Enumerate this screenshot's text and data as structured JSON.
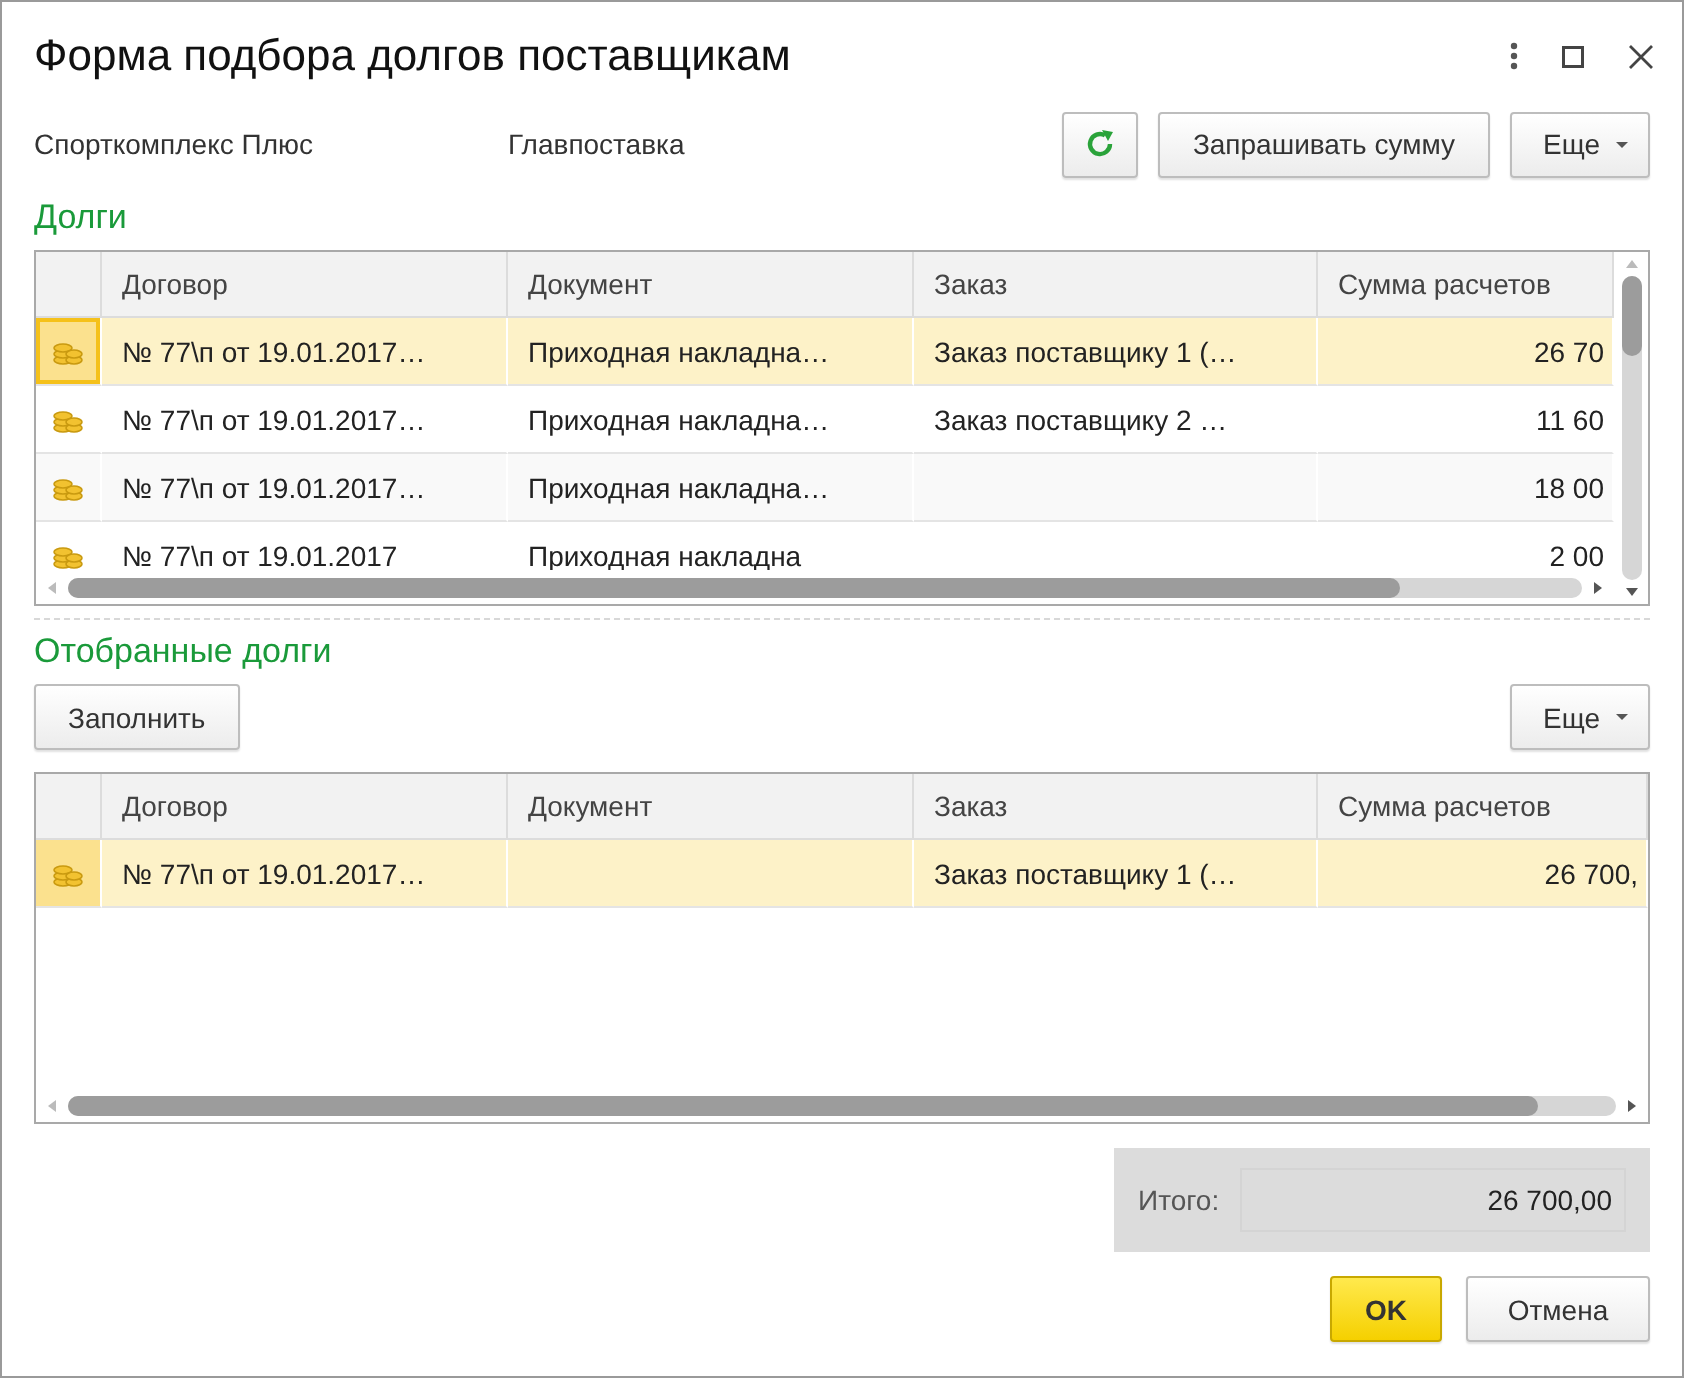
{
  "window": {
    "title": "Форма подбора долгов поставщикам"
  },
  "header": {
    "labels": [
      "Спорткомплекс Плюс",
      "Главпоставка"
    ],
    "buttons": [
      {
        "kind": "refresh"
      },
      {
        "kind": "text",
        "label": "Запрашивать сумму"
      },
      {
        "kind": "menu",
        "label": "Еще"
      }
    ]
  },
  "debts": {
    "title": "Долги",
    "columns": [
      "Договор",
      "Документ",
      "Заказ",
      "Сумма расчетов"
    ],
    "rows": [
      {
        "contract": "№ 77\\п от 19.01.2017…",
        "document": "Приходная накладна…",
        "order": "Заказ поставщику 1 (…",
        "sum": "26 70",
        "selected": true
      },
      {
        "contract": "№ 77\\п от 19.01.2017…",
        "document": "Приходная накладна…",
        "order": "Заказ поставщику 2 …",
        "sum": "11 60",
        "selected": false
      },
      {
        "contract": "№ 77\\п от 19.01.2017…",
        "document": "Приходная накладна…",
        "sum": "18 00",
        "selected": false
      },
      {
        "contract": "№ 77\\п от 19.01.2017",
        "document": "Приходная накладна",
        "sum": "2 00",
        "selected": false
      }
    ]
  },
  "selected_debts": {
    "title": "Отобранные долги",
    "fill_button": "Заполнить",
    "more_button": "Еще",
    "columns": [
      "Договор",
      "Документ",
      "Заказ",
      "Сумма расчетов"
    ],
    "rows": [
      {
        "contract": "№ 77\\п от 19.01.2017…",
        "order": "Заказ поставщику 1 (…",
        "sum": "26 700,",
        "selected": true
      }
    ]
  },
  "total": {
    "label": "Итого:",
    "value": "26 700,00"
  },
  "buttons": [
    {
      "kind": "primary",
      "label": "OK"
    },
    {
      "kind": "default",
      "label": "Отмена"
    }
  ]
}
